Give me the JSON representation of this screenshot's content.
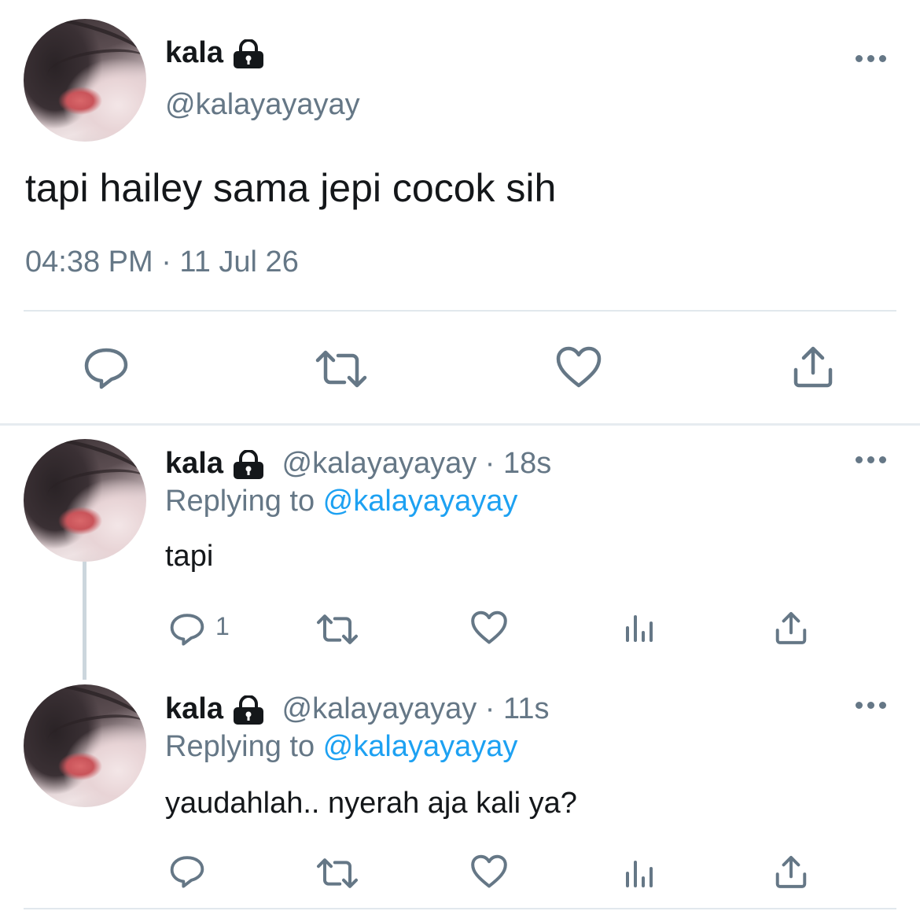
{
  "main_tweet": {
    "name": "kala",
    "handle": "@kalayayayay",
    "text": "tapi hailey sama jepi cocok sih",
    "timestamp": "04:38 PM · 11 Jul 26",
    "actions": [
      "reply-icon",
      "retweet-icon",
      "like-icon",
      "share-icon"
    ]
  },
  "replies": [
    {
      "name": "kala",
      "handle": "@kalayayayay",
      "time": "18s",
      "replying_prefix": "Replying to ",
      "replying_to": "@kalayayayay",
      "text": "tapi",
      "reply_count": "1"
    },
    {
      "name": "kala",
      "handle": "@kalayayayay",
      "time": "11s",
      "replying_prefix": "Replying to ",
      "replying_to": "@kalayayayay",
      "text": "yaudahlah.. nyerah aja kali ya?",
      "reply_count": ""
    }
  ],
  "colors": {
    "text": "#14171a",
    "secondary": "#657786",
    "accent": "#1da1f2",
    "divider": "#e1e8ed"
  }
}
